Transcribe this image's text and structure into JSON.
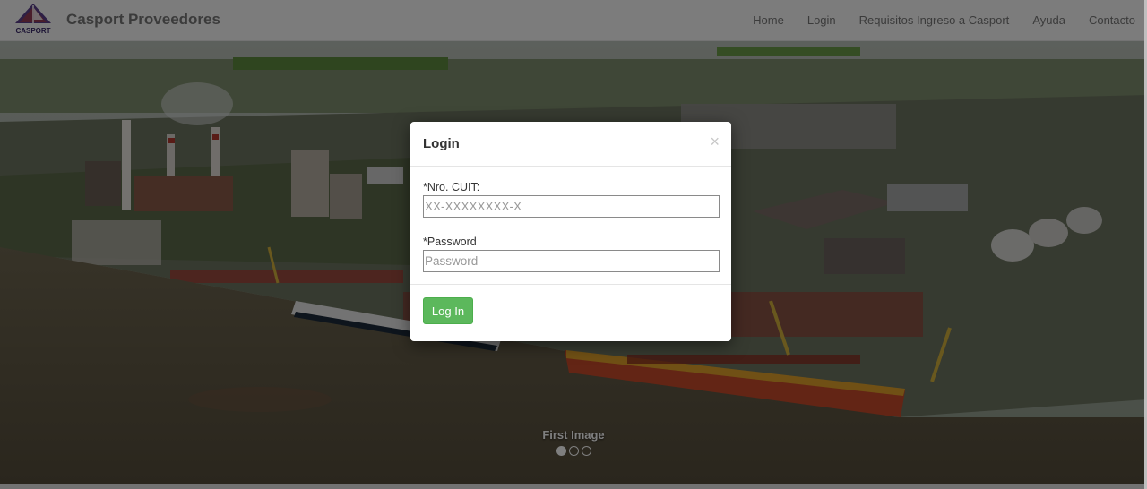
{
  "app": {
    "brand_name": "Casport Proveedores",
    "logo_text": "CASPORT"
  },
  "nav": {
    "items": [
      "Home",
      "Login",
      "Requisitos Ingreso a Casport",
      "Ayuda",
      "Contacto"
    ]
  },
  "carousel": {
    "caption": "First Image",
    "indicator_count": 3,
    "active_index": 0
  },
  "login_modal": {
    "title": "Login",
    "close_label": "×",
    "cuit_label": "*Nro. CUIT:",
    "cuit_placeholder": "XX-XXXXXXXX-X",
    "cuit_value": "",
    "password_label": "*Password",
    "password_placeholder": "Password",
    "password_value": "",
    "submit_label": "Log In"
  },
  "colors": {
    "primary_button": "#5cb85c",
    "navbar_bg": "#f8f8f8",
    "logo_purple": "#5b3f8a"
  }
}
